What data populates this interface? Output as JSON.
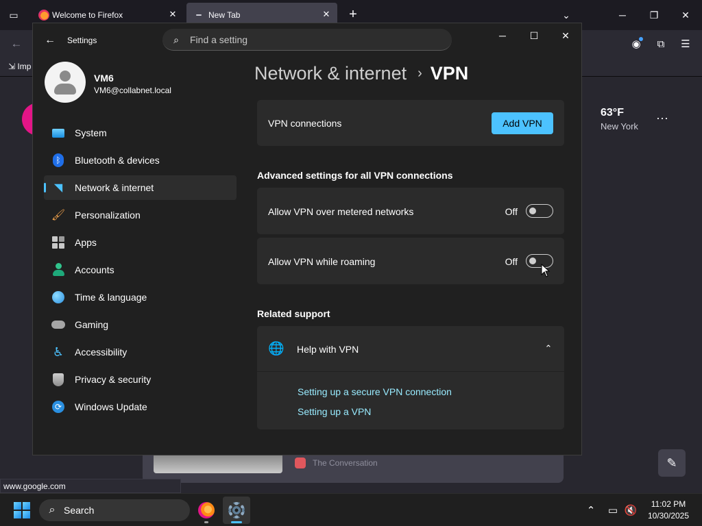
{
  "firefox": {
    "tabs": [
      {
        "title": "Welcome to Firefox",
        "close": "✕"
      },
      {
        "title": "New Tab",
        "close": "✕"
      }
    ],
    "new_tab_symbol": "+",
    "toolbar": {
      "back": "←"
    },
    "bookmarks": {
      "import_label": "Imp"
    },
    "weather": {
      "temp": "63°F",
      "city": "New York",
      "more": "···"
    },
    "story": {
      "source": "The Conversation"
    },
    "customize_symbol": "✎",
    "status_url": "www.google.com"
  },
  "settings": {
    "app_title": "Settings",
    "back_symbol": "←",
    "search": {
      "placeholder": "Find a setting",
      "value": ""
    },
    "profile": {
      "name": "VM6",
      "email": "VM6@collabnet.local"
    },
    "nav": [
      {
        "label": "System",
        "icon": "system-icon"
      },
      {
        "label": "Bluetooth & devices",
        "icon": "bluetooth-icon"
      },
      {
        "label": "Network & internet",
        "icon": "wifi-icon",
        "selected": true
      },
      {
        "label": "Personalization",
        "icon": "brush-icon"
      },
      {
        "label": "Apps",
        "icon": "apps-icon"
      },
      {
        "label": "Accounts",
        "icon": "accounts-icon"
      },
      {
        "label": "Time & language",
        "icon": "globe-icon"
      },
      {
        "label": "Gaming",
        "icon": "gamepad-icon"
      },
      {
        "label": "Accessibility",
        "icon": "accessibility-icon"
      },
      {
        "label": "Privacy & security",
        "icon": "shield-icon"
      },
      {
        "label": "Windows Update",
        "icon": "update-icon"
      }
    ],
    "breadcrumb": {
      "parent": "Network & internet",
      "separator": "›",
      "current": "VPN"
    },
    "vpn_connections": {
      "label": "VPN connections",
      "button": "Add VPN"
    },
    "advanced": {
      "title": "Advanced settings for all VPN connections",
      "items": [
        {
          "label": "Allow VPN over metered networks",
          "state": "Off",
          "on": false
        },
        {
          "label": "Allow VPN while roaming",
          "state": "Off",
          "on": false
        }
      ]
    },
    "related": {
      "title": "Related support",
      "help_title": "Help with VPN",
      "links": [
        "Setting up a secure VPN connection",
        "Setting up a VPN"
      ]
    }
  },
  "taskbar": {
    "search_label": "Search",
    "time": "11:02 PM",
    "date": "10/30/2025"
  },
  "colors": {
    "accent": "#4cc2ff",
    "link": "#99ebff",
    "window_bg": "#202020",
    "card_bg": "#2b2b2b"
  }
}
